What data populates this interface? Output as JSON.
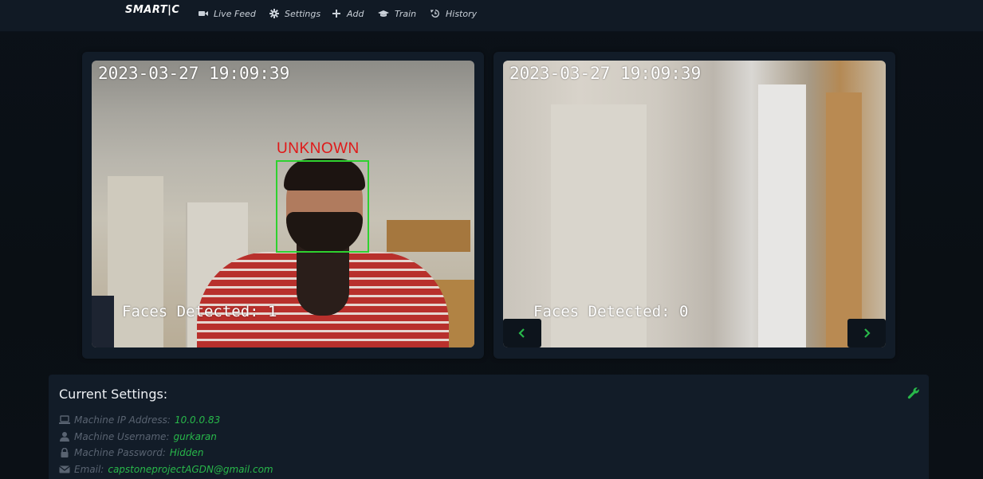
{
  "navbar": {
    "brand": "SMART|C",
    "items": [
      {
        "label": "Live Feed",
        "icon": "video-camera-icon"
      },
      {
        "label": "Settings",
        "icon": "gear-icon"
      },
      {
        "label": "Add",
        "icon": "plus-icon"
      },
      {
        "label": "Train",
        "icon": "graduation-cap-icon"
      },
      {
        "label": "History",
        "icon": "history-icon"
      }
    ]
  },
  "cameras": [
    {
      "timestamp": "2023-03-27 19:09:39",
      "faces_detected": "Faces Detected: 1",
      "detection_label": "UNKNOWN"
    },
    {
      "timestamp": "2023-03-27 19:09:39",
      "faces_detected": "Faces Detected: 0"
    }
  ],
  "carousel": {
    "prev_icon": "chevron-left-icon",
    "next_icon": "chevron-right-icon"
  },
  "settings": {
    "title": "Current Settings:",
    "edit_icon": "wrench-icon",
    "rows": [
      {
        "icon": "laptop-icon",
        "label": "Machine IP Address:",
        "value": "10.0.0.83"
      },
      {
        "icon": "user-icon",
        "label": "Machine Username:",
        "value": "gurkaran"
      },
      {
        "icon": "lock-icon",
        "label": "Machine Password:",
        "value": "Hidden"
      },
      {
        "icon": "envelope-icon",
        "label": "Email:",
        "value": "capstoneprojectAGDN@gmail.com"
      }
    ]
  },
  "colors": {
    "accent_green": "#28b84a",
    "detection_box": "#2fd12f",
    "unknown_red": "#e01818",
    "panel_bg": "#121c28",
    "navbar_bg": "#111a25"
  }
}
